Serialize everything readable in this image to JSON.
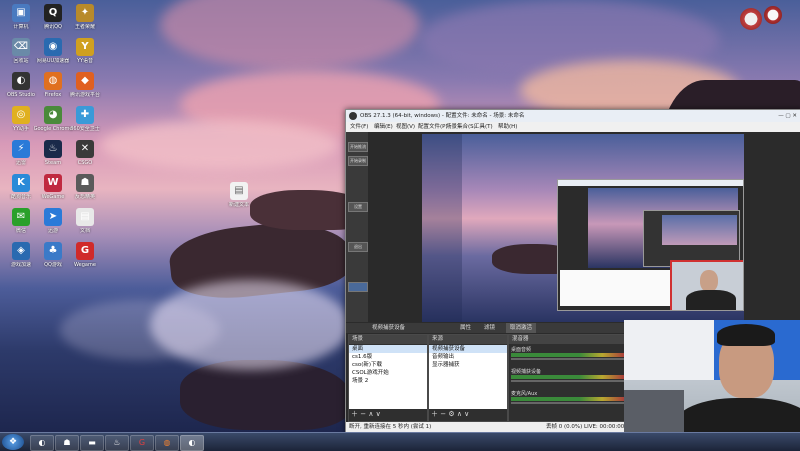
{
  "desktop": {
    "icons": [
      {
        "label": "计算机",
        "glyph": "▣",
        "color": "#4a7ac0",
        "icon": "computer-icon"
      },
      {
        "label": "腾讯QQ",
        "glyph": "Q",
        "color": "#222222",
        "icon": "qq-icon"
      },
      {
        "label": "王者荣耀",
        "glyph": "✦",
        "color": "#b88a2a",
        "icon": "game-icon"
      },
      {
        "label": "回收站",
        "glyph": "⌫",
        "color": "#6a8aa8",
        "icon": "recycle-bin-icon"
      },
      {
        "label": "网易UU加速器",
        "glyph": "◉",
        "color": "#2a6ab0",
        "icon": "uu-accelerator-icon"
      },
      {
        "label": "YY语音",
        "glyph": "Y",
        "color": "#d0a020",
        "icon": "yy-icon"
      },
      {
        "label": "OBS Studio",
        "glyph": "◐",
        "color": "#333333",
        "icon": "obs-icon"
      },
      {
        "label": "Firefox",
        "glyph": "◍",
        "color": "#e07020",
        "icon": "firefox-icon"
      },
      {
        "label": "腾讯游戏平台",
        "glyph": "◆",
        "color": "#e06020",
        "icon": "tencent-games-icon"
      },
      {
        "label": "YY助手",
        "glyph": "◎",
        "color": "#e0b020",
        "icon": "yy-assistant-icon"
      },
      {
        "label": "Google Chrome",
        "glyph": "◕",
        "color": "#4a8a3a",
        "icon": "chrome-icon"
      },
      {
        "label": "360安全卫士",
        "glyph": "✚",
        "color": "#3a9ad8",
        "icon": "360-icon"
      },
      {
        "label": "迅雷",
        "glyph": "⚡",
        "color": "#2a7ad8",
        "icon": "thunder-icon"
      },
      {
        "label": "Steam",
        "glyph": "♨",
        "color": "#1a2a4a",
        "icon": "steam-icon"
      },
      {
        "label": "CSGO",
        "glyph": "✕",
        "color": "#3a3a3a",
        "icon": "csgo-icon"
      },
      {
        "label": "酷狗音乐",
        "glyph": "K",
        "color": "#2a8ad8",
        "icon": "kugou-icon"
      },
      {
        "label": "WeGame",
        "glyph": "W",
        "color": "#c02a40",
        "icon": "wegame-icon"
      },
      {
        "label": "反恐精英",
        "glyph": "☗",
        "color": "#5a5a5a",
        "icon": "cs-icon"
      },
      {
        "label": "微信",
        "glyph": "✉",
        "color": "#2aa02a",
        "icon": "wechat-icon"
      },
      {
        "label": "迅游",
        "glyph": "➤",
        "color": "#2a7ad8",
        "icon": "xunyou-icon"
      },
      {
        "label": "文档",
        "glyph": "▤",
        "color": "#e8e8e8",
        "icon": "document-icon"
      },
      {
        "label": "游戏加速",
        "glyph": "◈",
        "color": "#2a6ab0",
        "icon": "booster-icon"
      },
      {
        "label": "QQ游戏",
        "glyph": "♣",
        "color": "#3a7ac8",
        "icon": "qqgame-icon"
      },
      {
        "label": "Wegame",
        "glyph": "G",
        "color": "#d02a2a",
        "icon": "g-icon"
      }
    ],
    "file_label": "新建文本"
  },
  "obs": {
    "title": "OBS 27.1.3 (64-bit, windows) - 配置文件: 未命名 - 场景: 未命名",
    "menu": [
      "文件(F)",
      "编辑(E)",
      "视图(V)",
      "配置文件(P)",
      "场景集合(S)",
      "工具(T)",
      "帮助(H)"
    ],
    "side_buttons": [
      "开始推流",
      "开始录制",
      "设置",
      "退出"
    ],
    "toolbar": {
      "source": "视频捕获设备",
      "props": "属性",
      "filters": "滤镜",
      "deactivate": "取消激活"
    },
    "docks": {
      "scenes": {
        "title": "场景",
        "items": [
          "桌面",
          "cs1.6版",
          "cso(新)下载",
          "CSOL游戏开始",
          "场景 2"
        ],
        "selected": 0
      },
      "sources": {
        "title": "来源",
        "items": [
          "视频捕获设备",
          "音频输出",
          "显示器捕获"
        ],
        "selected": 0
      },
      "mixer": {
        "title": "混音器",
        "rows": [
          "桌面音频",
          "视频捕获设备",
          "麦克风/Aux"
        ]
      }
    },
    "status": {
      "left": "断开, 重新连接在 5 秒内 (尝试 1)",
      "right": "丢帧 0 (0.0%)   LIVE: 00:00:00   REC: 00:00:00   CPU: 12.9%, 30.00 fps"
    }
  },
  "tray": {
    "clock_icon": "clock-icon",
    "tool_icon": "gadget-icon"
  }
}
